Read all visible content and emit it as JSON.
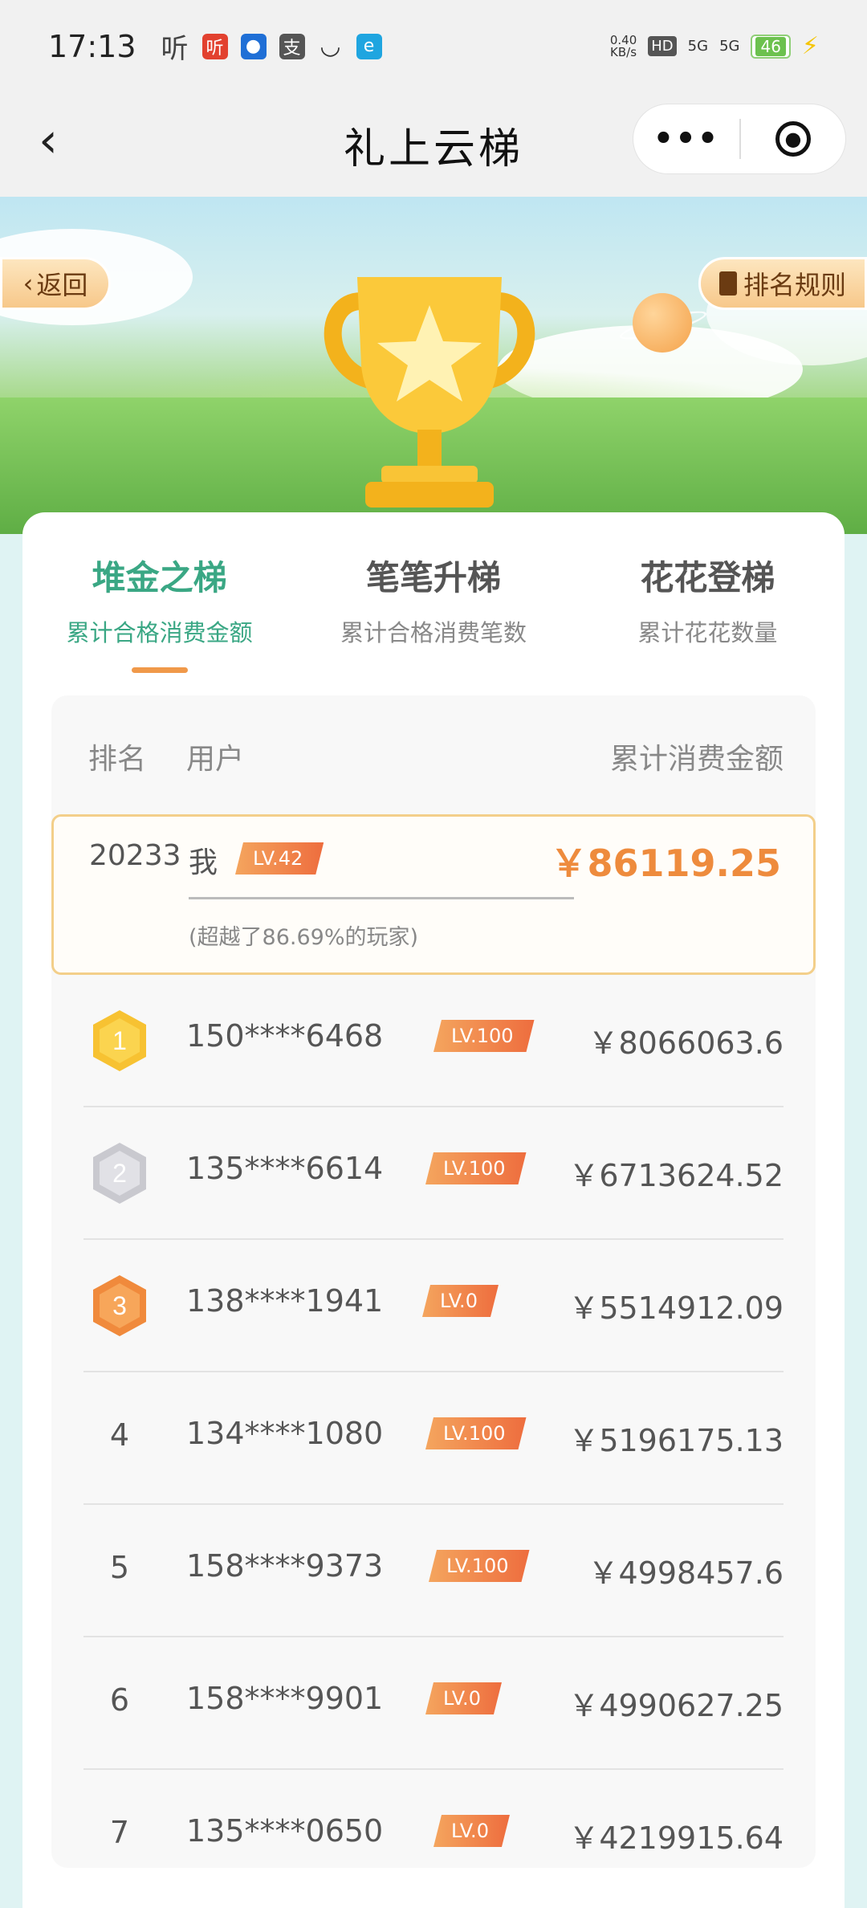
{
  "status_bar": {
    "time": "17:13",
    "listen_glyph": "听",
    "app_icons": [
      "听",
      "●",
      "支",
      "◡",
      "e"
    ],
    "speed": "0.40",
    "speed_unit": "KB/s",
    "hd": "HD",
    "signal1": "5G",
    "signal2": "5G",
    "battery": "46"
  },
  "nav": {
    "back_icon": "chevron-left-icon",
    "title": "礼上云梯",
    "more_label": "•••",
    "close_icon": "close-circle-icon"
  },
  "hero": {
    "back_label": "返回",
    "rules_label": "排名规则"
  },
  "tabs": [
    {
      "title": "堆金之梯",
      "subtitle": "累计合格消费金额",
      "active": true
    },
    {
      "title": "笔笔升梯",
      "subtitle": "累计合格消费笔数",
      "active": false
    },
    {
      "title": "花花登梯",
      "subtitle": "累计花花数量",
      "active": false
    }
  ],
  "table": {
    "headers": {
      "rank": "排名",
      "user": "用户",
      "amount": "累计消费金额"
    },
    "me": {
      "rank": "20233",
      "name": "我",
      "level": "LV.42",
      "amount": "￥86119.25",
      "subtitle": "(超越了86.69%的玩家)"
    },
    "rows": [
      {
        "rank": "1",
        "user": "150****6468",
        "level": "LV.100",
        "amount": "￥8066063.6"
      },
      {
        "rank": "2",
        "user": "135****6614",
        "level": "LV.100",
        "amount": "￥6713624.52"
      },
      {
        "rank": "3",
        "user": "138****1941",
        "level": "LV.0",
        "amount": "￥5514912.09"
      },
      {
        "rank": "4",
        "user": "134****1080",
        "level": "LV.100",
        "amount": "￥5196175.13"
      },
      {
        "rank": "5",
        "user": "158****9373",
        "level": "LV.100",
        "amount": "￥4998457.6"
      },
      {
        "rank": "6",
        "user": "158****9901",
        "level": "LV.0",
        "amount": "￥4990627.25"
      },
      {
        "rank": "7",
        "user": "135****0650",
        "level": "LV.0",
        "amount": "￥4219915.64"
      }
    ]
  },
  "colors": {
    "accent_green": "#3aa784",
    "accent_orange": "#ee8b3d",
    "gold": "#f7c232",
    "silver": "#c9c9cf",
    "bronze": "#f08a3c"
  }
}
